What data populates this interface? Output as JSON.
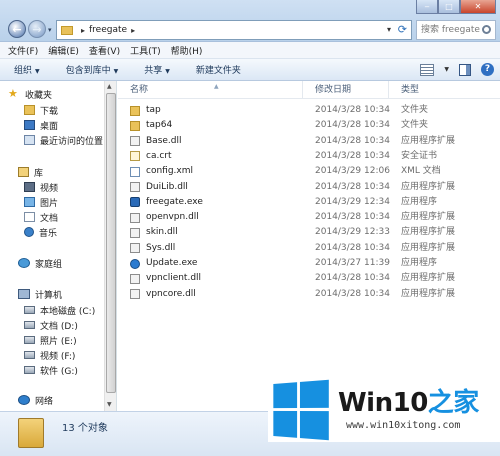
{
  "window": {
    "breadcrumb": [
      "freegate"
    ],
    "search_placeholder": "搜索 freegate"
  },
  "menu": [
    "文件(F)",
    "编辑(E)",
    "查看(V)",
    "工具(T)",
    "帮助(H)"
  ],
  "toolbar": {
    "organize": "组织",
    "include_in_library": "包含到库中",
    "share": "共享",
    "new_folder": "新建文件夹"
  },
  "nav": {
    "favorites": "收藏夹",
    "downloads": "下载",
    "desktop": "桌面",
    "recent": "最近访问的位置",
    "libraries": "库",
    "videos": "视频",
    "pictures": "图片",
    "documents": "文档",
    "music": "音乐",
    "homegroup": "家庭组",
    "computer": "计算机",
    "drive_c": "本地磁盘 (C:)",
    "drive_d": "文档 (D:)",
    "drive_e": "照片 (E:)",
    "drive_f": "视频 (F:)",
    "drive_g": "软件 (G:)",
    "network": "网络"
  },
  "columns": {
    "name": "名称",
    "modified": "修改日期",
    "type": "类型"
  },
  "files": [
    {
      "name": "tap",
      "date": "2014/3/28 10:34",
      "type": "文件夹",
      "icon": "folder-icon"
    },
    {
      "name": "tap64",
      "date": "2014/3/28 10:34",
      "type": "文件夹",
      "icon": "folder-icon"
    },
    {
      "name": "Base.dll",
      "date": "2014/3/28 10:34",
      "type": "应用程序扩展",
      "icon": "dll-icon"
    },
    {
      "name": "ca.crt",
      "date": "2014/3/28 10:34",
      "type": "安全证书",
      "icon": "certificate-icon"
    },
    {
      "name": "config.xml",
      "date": "2014/3/29 12:06",
      "type": "XML 文档",
      "icon": "xml-icon"
    },
    {
      "name": "DuiLib.dll",
      "date": "2014/3/28 10:34",
      "type": "应用程序扩展",
      "icon": "dll-icon"
    },
    {
      "name": "freegate.exe",
      "date": "2014/3/29 12:34",
      "type": "应用程序",
      "icon": "exe-icon"
    },
    {
      "name": "openvpn.dll",
      "date": "2014/3/28 10:34",
      "type": "应用程序扩展",
      "icon": "dll-icon"
    },
    {
      "name": "skin.dll",
      "date": "2014/3/29 12:33",
      "type": "应用程序扩展",
      "icon": "dll-icon"
    },
    {
      "name": "Sys.dll",
      "date": "2014/3/28 10:34",
      "type": "应用程序扩展",
      "icon": "dll-icon"
    },
    {
      "name": "Update.exe",
      "date": "2014/3/27 11:39",
      "type": "应用程序",
      "icon": "update-icon"
    },
    {
      "name": "vpnclient.dll",
      "date": "2014/3/28 10:34",
      "type": "应用程序扩展",
      "icon": "dll-icon"
    },
    {
      "name": "vpncore.dll",
      "date": "2014/3/28 10:34",
      "type": "应用程序扩展",
      "icon": "dll-icon"
    }
  ],
  "status": {
    "count": "13 个对象"
  },
  "watermark": {
    "title_prefix": "Win10",
    "title_suffix": "之家",
    "url": "www.win10xitong.com"
  }
}
